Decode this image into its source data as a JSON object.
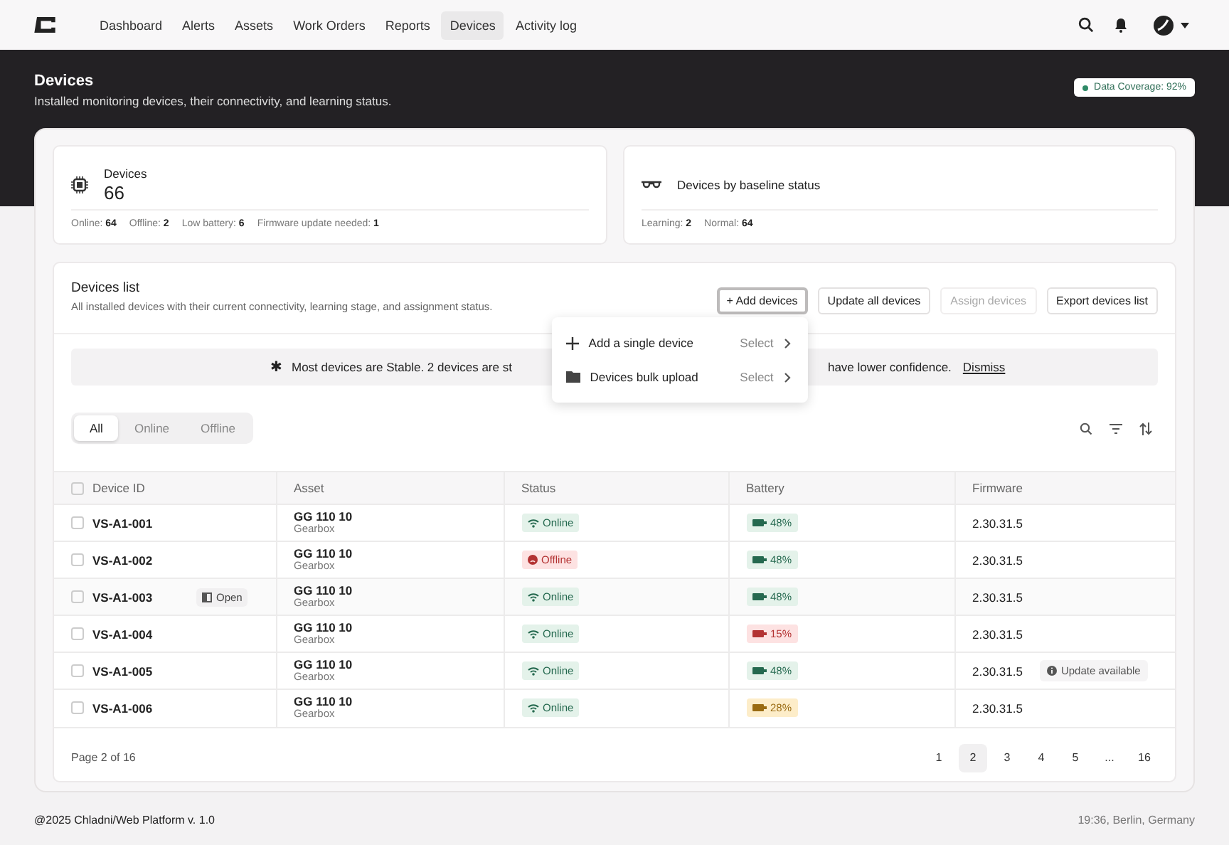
{
  "nav": {
    "items": [
      {
        "label": "Dashboard",
        "selected": false
      },
      {
        "label": "Alerts",
        "selected": false
      },
      {
        "label": "Assets",
        "selected": false
      },
      {
        "label": "Work Orders",
        "selected": false
      },
      {
        "label": "Reports",
        "selected": false
      },
      {
        "label": "Devices",
        "selected": true
      },
      {
        "label": "Activity log",
        "selected": false
      }
    ]
  },
  "header": {
    "title": "Devices",
    "subtitle": "Installed monitoring devices, their connectivity, and learning status.",
    "coverage": "Data Coverage: 92%"
  },
  "stats": [
    {
      "kind": "chip",
      "title": "Devices",
      "value": "66",
      "metrics": [
        {
          "label": "Online:",
          "value": "64"
        },
        {
          "label": "Offline:",
          "value": "2"
        },
        {
          "label": "Low battery:",
          "value": "6"
        },
        {
          "label": "Firmware update needed:",
          "value": "1"
        }
      ]
    },
    {
      "kind": "glasses",
      "title": "Devices by baseline status",
      "metrics": [
        {
          "label": "Learning:",
          "value": "2"
        },
        {
          "label": "Normal:",
          "value": "64"
        }
      ]
    }
  ],
  "list": {
    "title": "Devices list",
    "subtitle": "All installed devices with their current connectivity, learning stage, and assignment status.",
    "actions": [
      {
        "label": "+ Add devices",
        "disabled": false,
        "pressed": true
      },
      {
        "label": "Update all devices",
        "disabled": false,
        "pressed": false
      },
      {
        "label": "Assign devices",
        "disabled": true,
        "pressed": false
      },
      {
        "label": "Export devices list",
        "disabled": false,
        "pressed": false
      }
    ],
    "menu": [
      {
        "kind": "plus",
        "label": "Add a single device",
        "action": "Select"
      },
      {
        "kind": "folder",
        "label": "Devices bulk upload",
        "action": "Select"
      }
    ],
    "banner": {
      "icon": "✱",
      "before": "Most devices are Stable. 2 devices are st",
      "after": "have lower confidence.",
      "link": "Dismiss"
    },
    "filters": [
      {
        "label": "All",
        "selected": true
      },
      {
        "label": "Online",
        "selected": false
      },
      {
        "label": "Offline",
        "selected": false
      }
    ],
    "columns": [
      "Device ID",
      "Asset",
      "Status",
      "Battery",
      "Firmware"
    ],
    "all_checked": false,
    "rows": [
      {
        "id": "VS-A1-001",
        "asset": "GG 110 10",
        "asset_type": "Gearbox",
        "status": {
          "kind": "online",
          "label": "Online"
        },
        "battery": {
          "kind": "ok",
          "label": "48%"
        },
        "firmware": "2.30.31.5",
        "hovered": false,
        "checked": false
      },
      {
        "id": "VS-A1-002",
        "asset": "GG 110 10",
        "asset_type": "Gearbox",
        "status": {
          "kind": "offline",
          "label": "Offline"
        },
        "battery": {
          "kind": "ok",
          "label": "48%"
        },
        "firmware": "2.30.31.5",
        "hovered": false,
        "checked": false
      },
      {
        "id": "VS-A1-003",
        "asset": "GG 110 10",
        "asset_type": "Gearbox",
        "status": {
          "kind": "online",
          "label": "Online"
        },
        "battery": {
          "kind": "ok",
          "label": "48%"
        },
        "firmware": "2.30.31.5",
        "hovered": true,
        "hover_action": "Open",
        "checked": false
      },
      {
        "id": "VS-A1-004",
        "asset": "GG 110 10",
        "asset_type": "Gearbox",
        "status": {
          "kind": "online",
          "label": "Online"
        },
        "battery": {
          "kind": "low",
          "label": "15%"
        },
        "firmware": "2.30.31.5",
        "hovered": false,
        "checked": false
      },
      {
        "id": "VS-A1-005",
        "asset": "GG 110 10",
        "asset_type": "Gearbox",
        "status": {
          "kind": "online",
          "label": "Online"
        },
        "battery": {
          "kind": "ok",
          "label": "48%"
        },
        "firmware": "2.30.31.5",
        "hovered": false,
        "firmware_note": "Update available",
        "checked": false
      },
      {
        "id": "VS-A1-006",
        "asset": "GG 110 10",
        "asset_type": "Gearbox",
        "status": {
          "kind": "online",
          "label": "Online"
        },
        "battery": {
          "kind": "medium",
          "label": "28%"
        },
        "firmware": "2.30.31.5",
        "hovered": false,
        "checked": false
      }
    ],
    "page_info": "Page 2 of 16",
    "pages": [
      {
        "label": "1",
        "selected": false
      },
      {
        "label": "2",
        "selected": true
      },
      {
        "label": "3",
        "selected": false
      },
      {
        "label": "4",
        "selected": false
      },
      {
        "label": "5",
        "selected": false
      },
      {
        "label": "...",
        "selected": false
      },
      {
        "label": "16",
        "selected": false
      }
    ]
  },
  "footer": {
    "left": "@2025 Chladni/Web Platform v. 1.0",
    "right": "19:36, Berlin, Germany"
  }
}
